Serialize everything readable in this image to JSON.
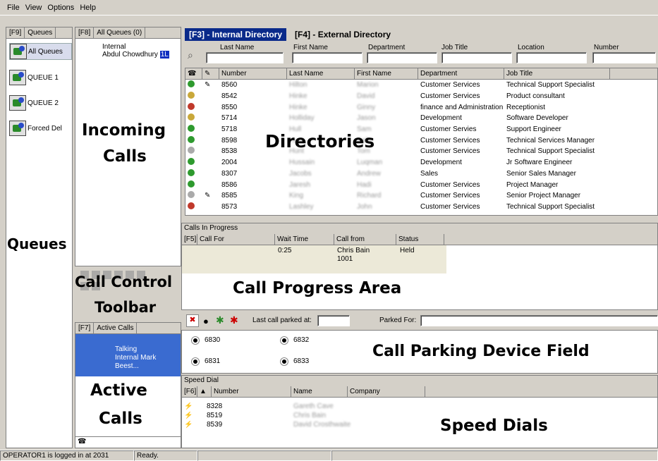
{
  "menu": [
    "File",
    "View",
    "Options",
    "Help"
  ],
  "queues": {
    "tab_key": "[F9]",
    "tab_label": "Queues",
    "items": [
      "All Queues",
      "QUEUE 1",
      "QUEUE 2",
      "Forced Del"
    ],
    "overlay_label": "Queues"
  },
  "incoming": {
    "tab_key": "[F8]",
    "tab_label": "All Queues (0)",
    "line1": "Internal",
    "line2": "Abdul Chowdhury",
    "badge": "1L",
    "overlay_line1": "Incoming",
    "overlay_line2": "Calls"
  },
  "call_control": {
    "overlay_line1": "Call Control",
    "overlay_line2": "Toolbar"
  },
  "active_calls": {
    "tab_key": "[F7]",
    "tab_label": "Active Calls",
    "status": "Talking",
    "detail": "Internal Mark Beest...",
    "overlay_line1": "Active",
    "overlay_line2": "Calls"
  },
  "directory": {
    "tabs": [
      "[F3] - Internal Directory",
      "[F4] - External Directory"
    ],
    "search_labels": [
      "Last Name",
      "First Name",
      "Department",
      "Job Title",
      "Location",
      "Number"
    ],
    "columns": [
      "Number",
      "Last Name",
      "First Name",
      "Department",
      "Job Title"
    ],
    "rows": [
      {
        "status": "green",
        "note": true,
        "number": "8560",
        "last": "Hilton",
        "first": "Marion",
        "dept": "Customer Services",
        "job": "Technical Support Specialist"
      },
      {
        "status": "yellow",
        "note": false,
        "number": "8542",
        "last": "Hinke",
        "first": "David",
        "dept": "Customer Services",
        "job": "Product consultant"
      },
      {
        "status": "red",
        "note": false,
        "number": "8550",
        "last": "Hinke",
        "first": "Ginny",
        "dept": "finance and Administration",
        "job": "Receptionist"
      },
      {
        "status": "yellow",
        "note": false,
        "number": "5714",
        "last": "Holliday",
        "first": "Jason",
        "dept": "Development",
        "job": "Software Developer"
      },
      {
        "status": "green",
        "note": false,
        "number": "5718",
        "last": "Hull",
        "first": "Sam",
        "dept": "Customer Servies",
        "job": "Support Engineer"
      },
      {
        "status": "green",
        "note": false,
        "number": "8598",
        "last": "Hunt",
        "first": "Sally",
        "dept": "Customer Services",
        "job": "Technical Services Manager"
      },
      {
        "status": "grey",
        "note": false,
        "number": "8538",
        "last": "Hunt",
        "first": "Tom",
        "dept": "Customer Services",
        "job": "Technical Support Specialist"
      },
      {
        "status": "green",
        "note": false,
        "number": "2004",
        "last": "Hussain",
        "first": "Luqman",
        "dept": "Development",
        "job": "Jr Software Engineer"
      },
      {
        "status": "green",
        "note": false,
        "number": "8307",
        "last": "Jacobs",
        "first": "Andrew",
        "dept": "Sales",
        "job": "Senior Sales Manager"
      },
      {
        "status": "green",
        "note": false,
        "number": "8586",
        "last": "Jaresh",
        "first": "Hadi",
        "dept": "Customer Services",
        "job": "Project Manager"
      },
      {
        "status": "grey",
        "note": true,
        "number": "8585",
        "last": "King",
        "first": "Richard",
        "dept": "Customer Services",
        "job": "Senior Project Manager"
      },
      {
        "status": "red",
        "note": false,
        "number": "8573",
        "last": "Lashley",
        "first": "John",
        "dept": "Customer Services",
        "job": "Technical Support Specialist"
      }
    ],
    "overlay_label": "Directories"
  },
  "progress": {
    "title": "Calls In Progress",
    "columns": [
      "[F5]",
      "Call For",
      "Wait Time",
      "Call from",
      "Status"
    ],
    "row": {
      "wait": "0:25",
      "from_name": "Chris Bain",
      "from_num": "1001",
      "status": "Held"
    },
    "overlay_label": "Call Progress Area"
  },
  "parking": {
    "last_parked_label": "Last call parked at:",
    "parked_for_label": "Parked For:",
    "devices": [
      "6830",
      "6832",
      "6831",
      "6833"
    ],
    "overlay_label": "Call Parking Device Field"
  },
  "speed": {
    "title": "Speed Dial",
    "columns": [
      "[F6]",
      "Number",
      "Name",
      "Company"
    ],
    "rows": [
      {
        "number": "8328",
        "name": "Gareth Cave"
      },
      {
        "number": "8519",
        "name": "Chris Bain"
      },
      {
        "number": "8539",
        "name": "David Crosthwaite"
      }
    ],
    "overlay_label": "Speed Dials"
  },
  "status_bar": {
    "login": "OPERATOR1 is logged in at 2031",
    "state": "Ready."
  },
  "colors": {
    "tab_active": "#0a2a8a",
    "active_call_bg": "#3a6bd0",
    "progress_row_bg": "#ece9d8"
  }
}
